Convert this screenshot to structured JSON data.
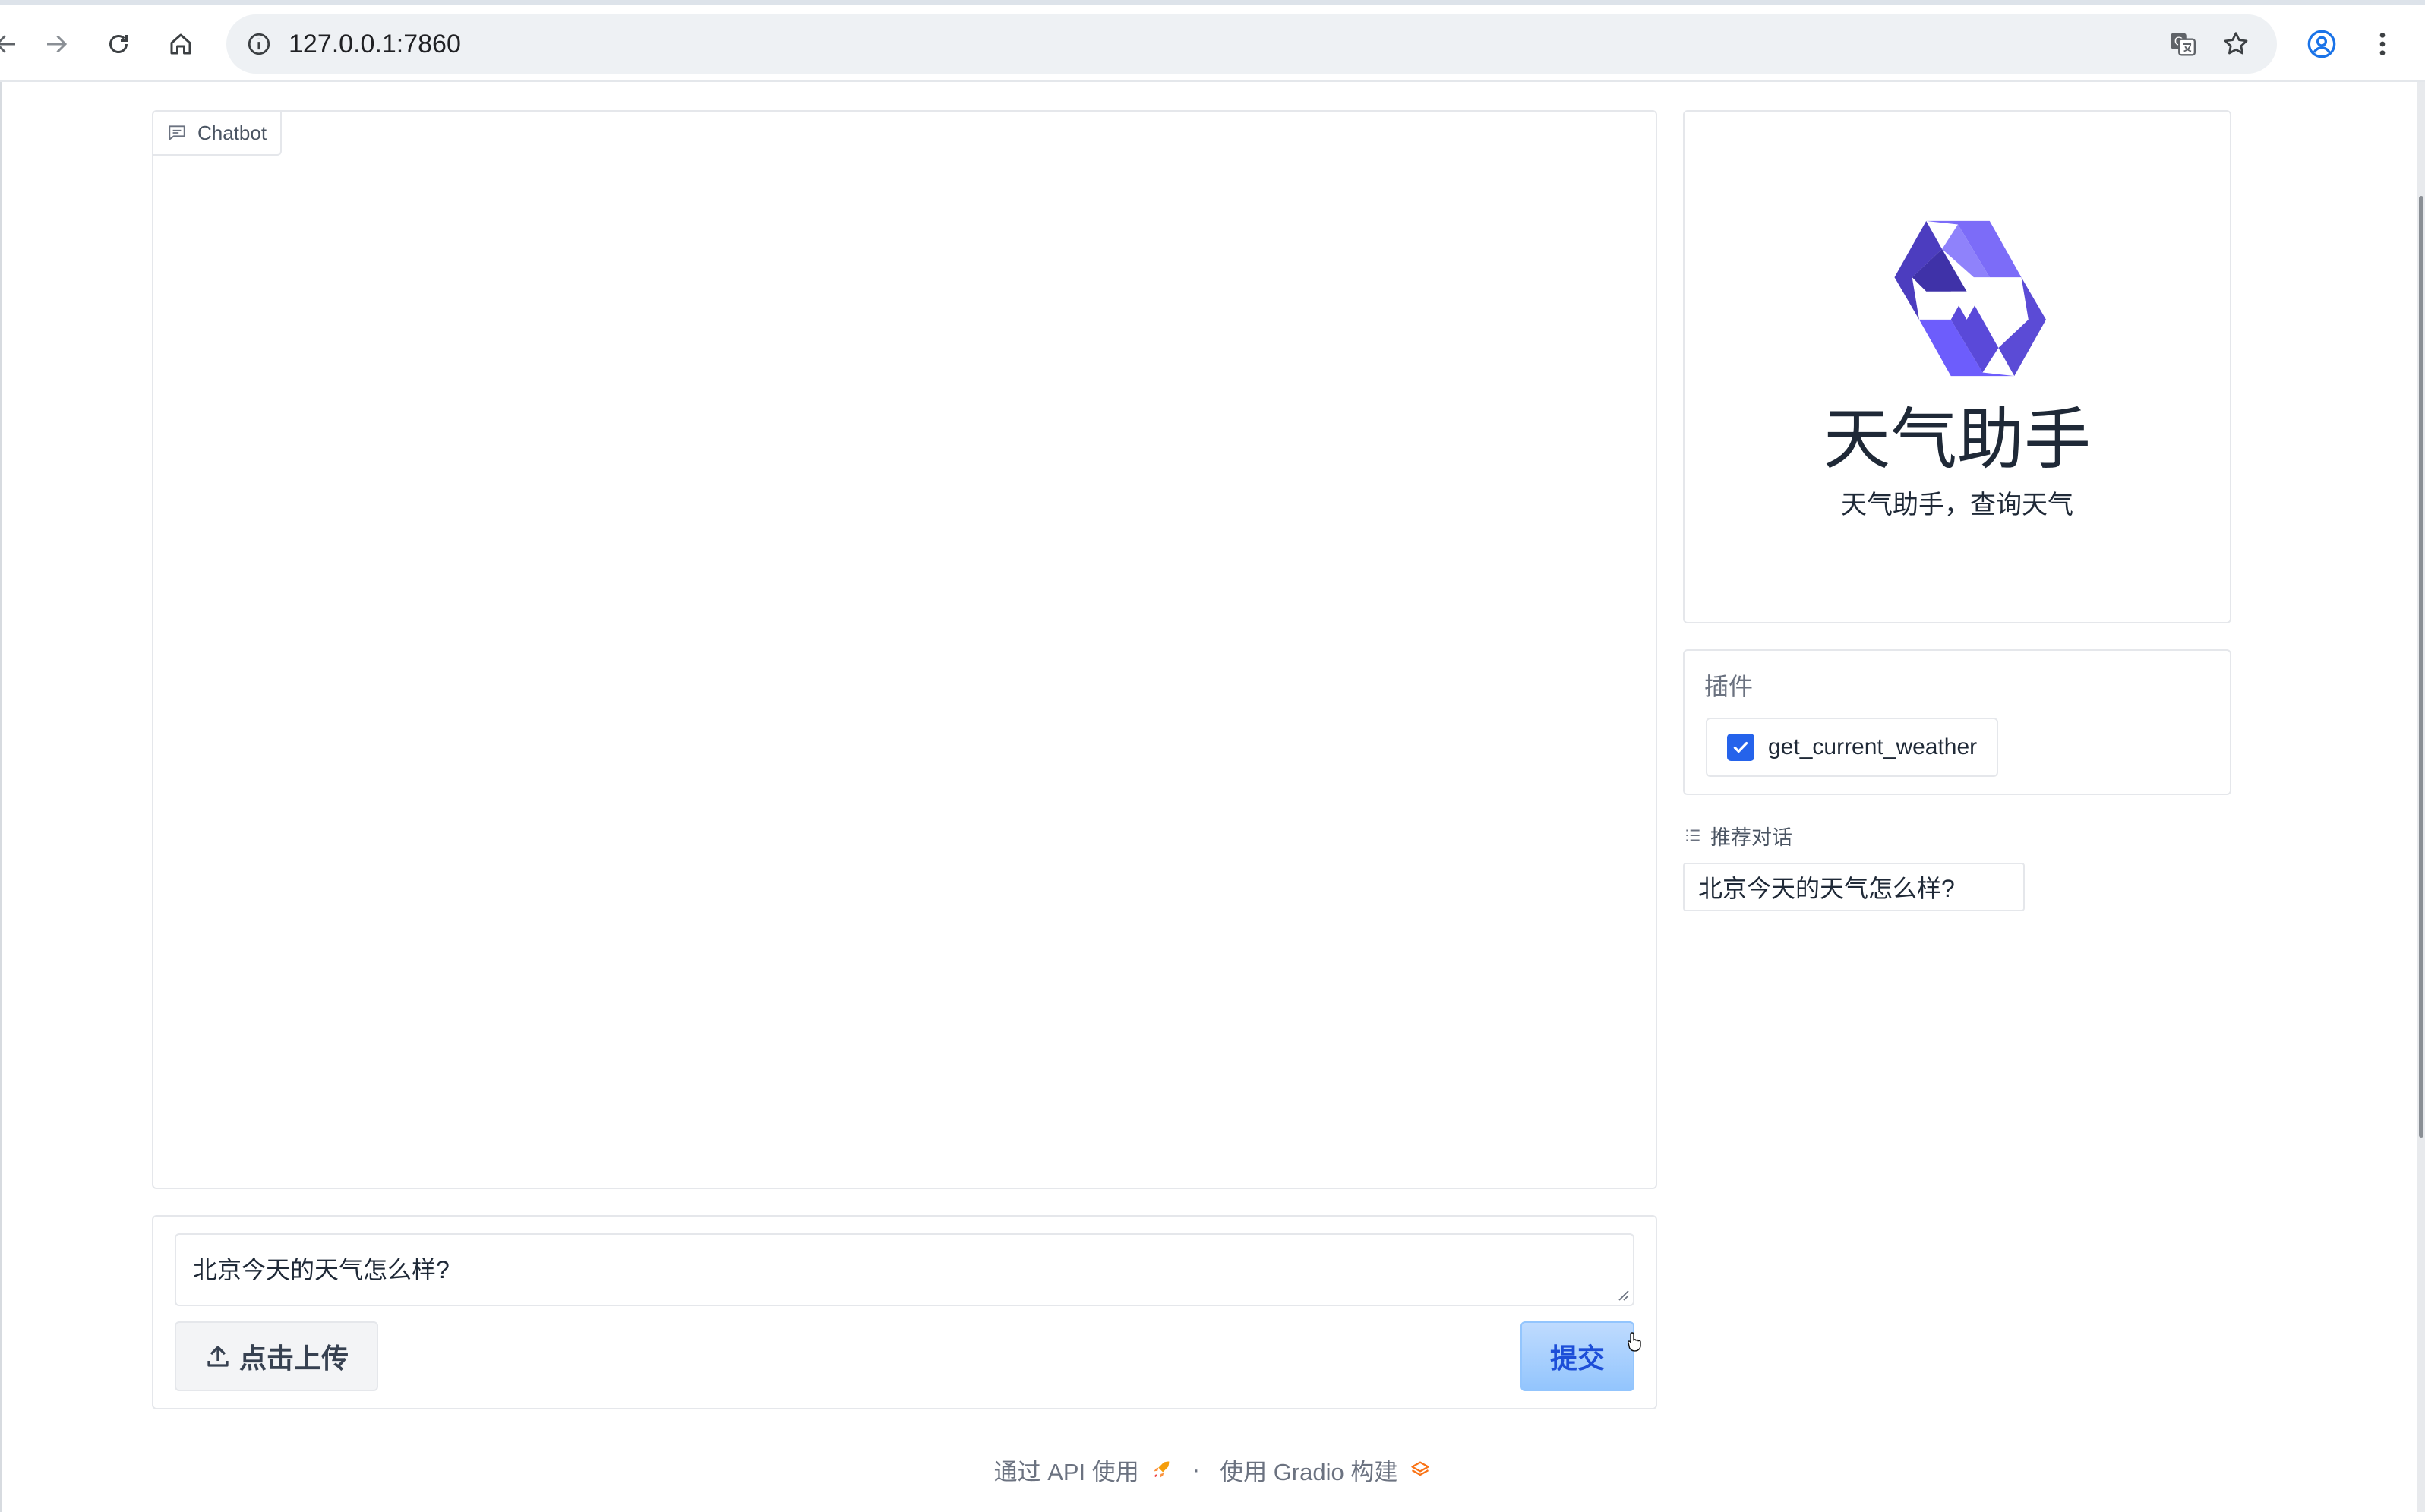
{
  "browser": {
    "url": "127.0.0.1:7860"
  },
  "chatbot": {
    "label": "Chatbot"
  },
  "input": {
    "value": "北京今天的天气怎么样?",
    "upload_label": "点击上传",
    "submit_label": "提交"
  },
  "agent": {
    "name": "天气助手",
    "description": "天气助手，查询天气"
  },
  "plugins": {
    "title": "插件",
    "items": [
      {
        "label": "get_current_weather",
        "checked": true
      }
    ]
  },
  "examples": {
    "title": "推荐对话",
    "items": [
      "北京今天的天气怎么样?"
    ]
  },
  "footer": {
    "api_label": "通过 API 使用",
    "separator": "·",
    "built_with": "使用 Gradio 构建"
  },
  "colors": {
    "accent": "#2563eb",
    "submit_bg": "#93c5fd",
    "logo": "#6d5dfc"
  }
}
